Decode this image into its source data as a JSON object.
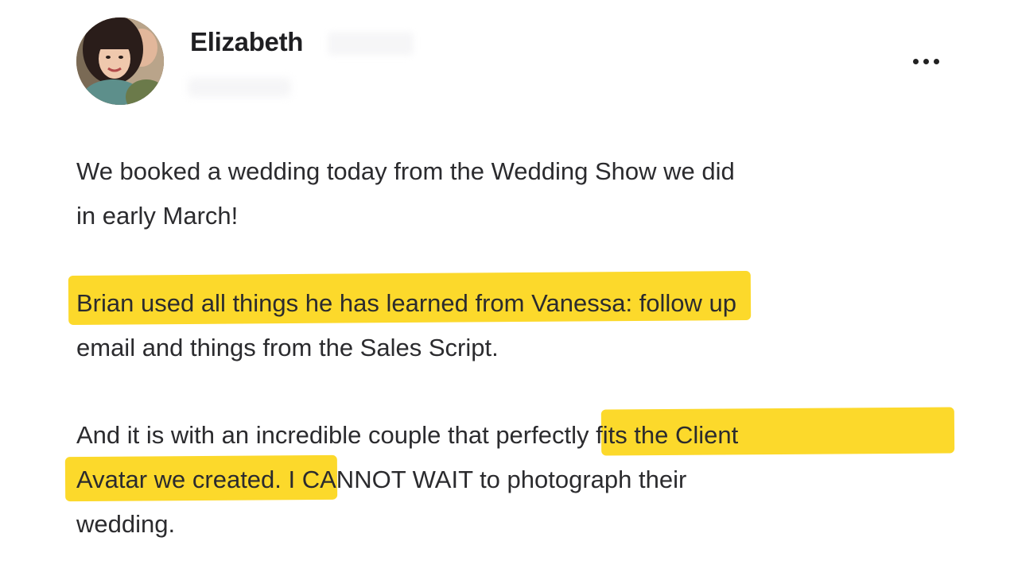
{
  "post": {
    "author_name": "Elizabeth",
    "more_icon": "more-horizontal-icon",
    "paragraphs": {
      "p1": {
        "line1": "We booked a wedding today from the Wedding Show we did",
        "line2": "in early March!"
      },
      "p2": {
        "line1_highlight": "Brian used all things he has learned from Vanessa",
        "line1_rest": ": follow up",
        "line2": "email and things from the Sales Script."
      },
      "p3": {
        "line1_plain": "And it is with an incredible couple that ",
        "line1_highlight": "perfectly fits the Client",
        "line2_highlight": "Avatar we created.",
        "line2_rest": " I CANNOT WAIT to photograph their",
        "line3": "wedding."
      }
    },
    "highlight_color": "#fcd92b",
    "text_color": "#2b2b2e"
  }
}
